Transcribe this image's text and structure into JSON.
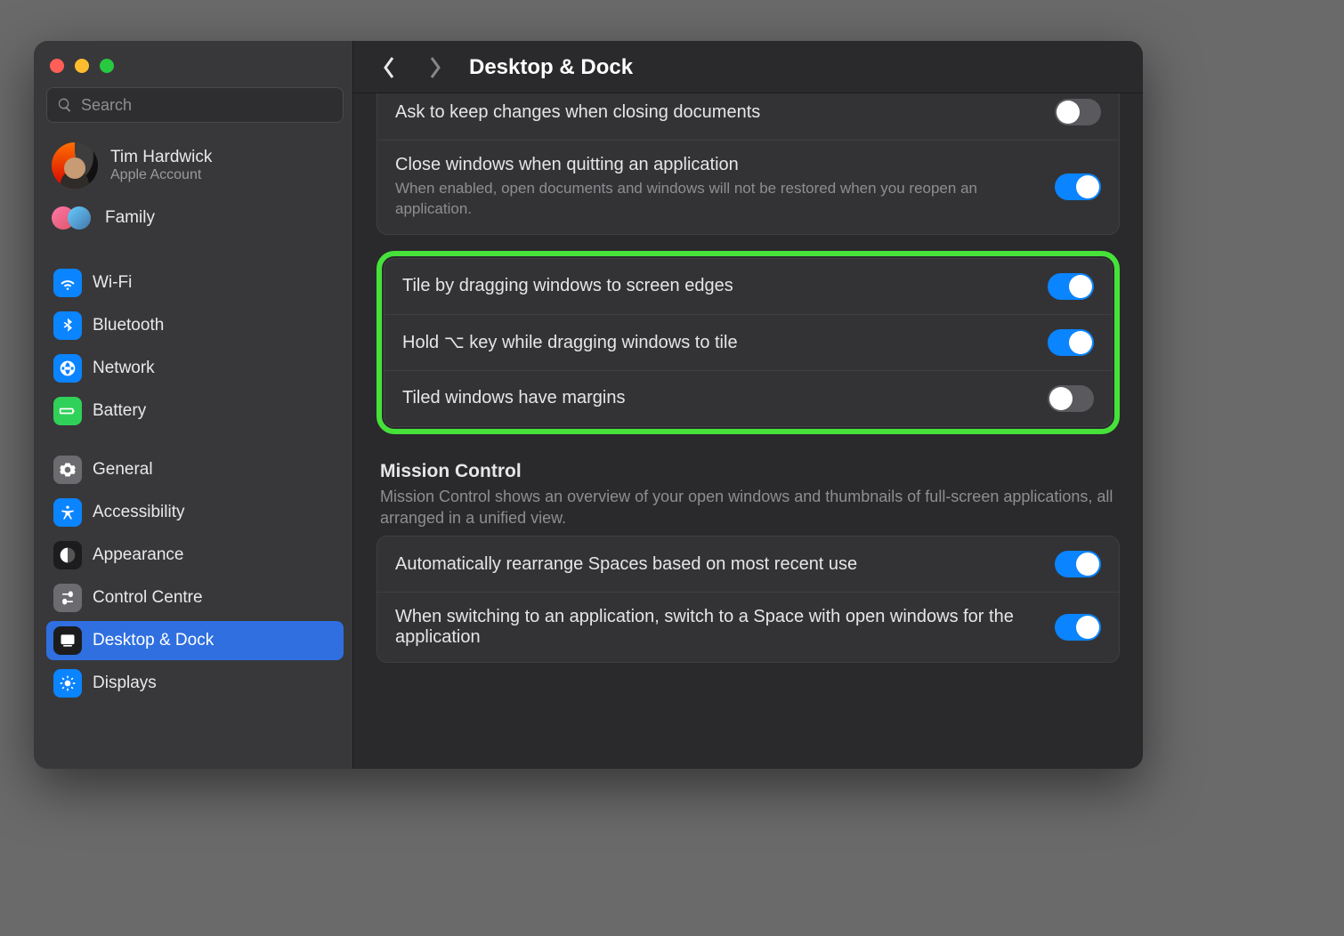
{
  "window": {
    "search_placeholder": "Search",
    "account": {
      "name": "Tim Hardwick",
      "subtitle": "Apple Account"
    },
    "family_label": "Family"
  },
  "sidebar": {
    "items": [
      {
        "label": "Wi-Fi"
      },
      {
        "label": "Bluetooth"
      },
      {
        "label": "Network"
      },
      {
        "label": "Battery"
      },
      {
        "label": "General"
      },
      {
        "label": "Accessibility"
      },
      {
        "label": "Appearance"
      },
      {
        "label": "Control Centre"
      },
      {
        "label": "Desktop & Dock"
      },
      {
        "label": "Displays"
      }
    ]
  },
  "header": {
    "title": "Desktop & Dock"
  },
  "settings": {
    "ask_keep_changes": {
      "label": "Ask to keep changes when closing documents",
      "on": false
    },
    "close_on_quit": {
      "label": "Close windows when quitting an application",
      "desc": "When enabled, open documents and windows will not be restored when you reopen an application.",
      "on": true
    },
    "tile_edges": {
      "label": "Tile by dragging windows to screen edges",
      "on": true
    },
    "tile_option": {
      "label": "Hold ⌥ key while dragging windows to tile",
      "on": true
    },
    "tile_margins": {
      "label": "Tiled windows have margins",
      "on": false
    },
    "mission_control": {
      "title": "Mission Control",
      "desc": "Mission Control shows an overview of your open windows and thumbnails of full-screen applications, all arranged in a unified view."
    },
    "auto_rearrange": {
      "label": "Automatically rearrange Spaces based on most recent use",
      "on": true
    },
    "switch_space": {
      "label": "When switching to an application, switch to a Space with open windows for the application",
      "on": true
    }
  }
}
